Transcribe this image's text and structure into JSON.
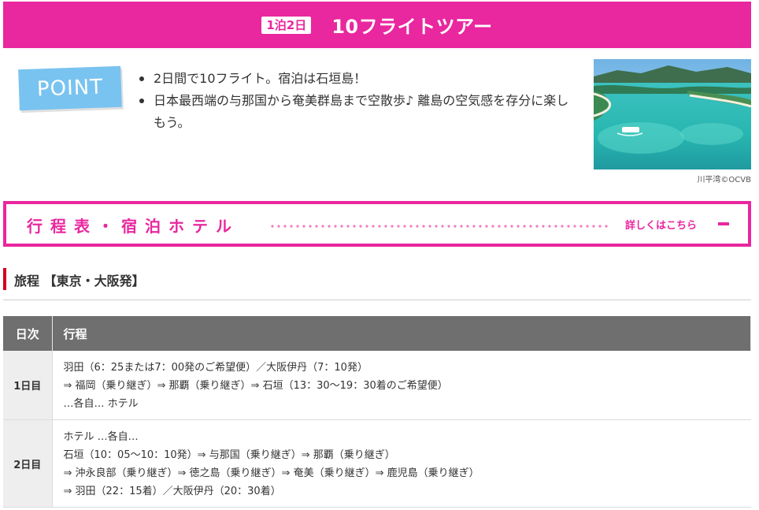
{
  "header": {
    "stay_badge": "1泊2日",
    "title": "10フライトツアー",
    "bg_color": "#e9279f"
  },
  "point": {
    "badge_label": "POINT",
    "items": [
      "2日間で10フライト。宿泊は石垣島！",
      "日本最西端の与那国から奄美群島まで空散歩♪ 離島の空気感を存分に楽しもう。"
    ],
    "photo_credit": "川平湾©OCVB"
  },
  "itinerary_bar": {
    "title": "行程表・宿泊ホテル",
    "details_link": "詳しくはこちら",
    "toggle_icon": "minus-icon"
  },
  "section": {
    "heading": "旅程 【東京・大阪発】",
    "accent_color": "#d3001f"
  },
  "table": {
    "headers": [
      "日次",
      "行程"
    ],
    "rows": [
      {
        "day": "1日目",
        "lines": [
          "羽田（6：25または7：00発のご希望便）／大阪伊丹（7：10発）",
          "⇒ 福岡（乗り継ぎ）⇒ 那覇（乗り継ぎ）⇒ 石垣（13：30〜19：30着のご希望便）",
          "…各自… ホテル"
        ]
      },
      {
        "day": "2日目",
        "lines": [
          "ホテル …各自…",
          "石垣（10：05〜10：10発）⇒ 与那国（乗り継ぎ）⇒ 那覇（乗り継ぎ）",
          "⇒ 沖永良部（乗り継ぎ）⇒ 徳之島（乗り継ぎ）⇒ 奄美（乗り継ぎ）⇒ 鹿児島（乗り継ぎ）",
          "⇒ 羽田（22：15着）／大阪伊丹（20：30着）"
        ]
      }
    ]
  }
}
